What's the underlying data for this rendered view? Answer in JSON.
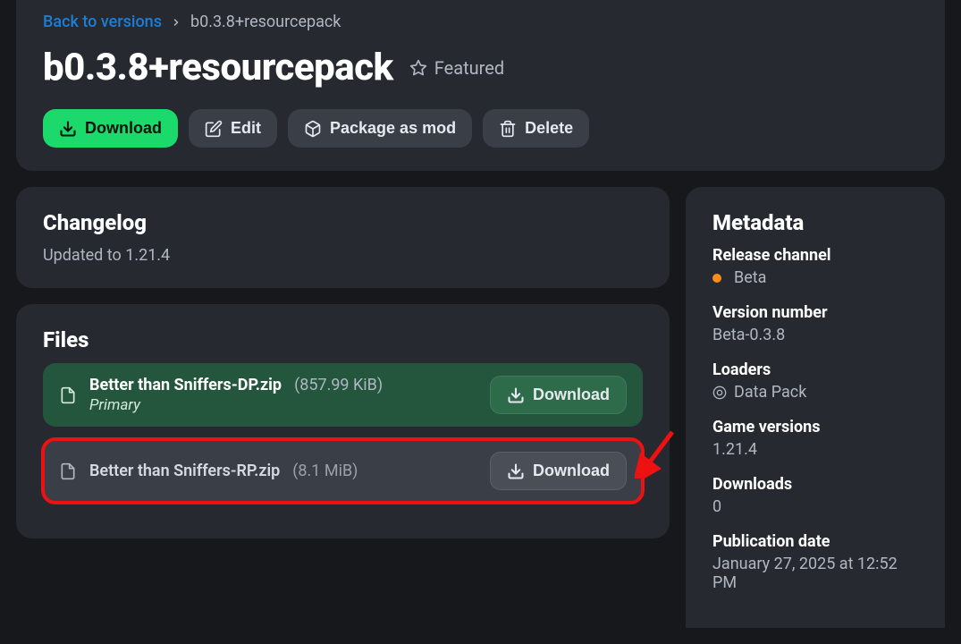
{
  "breadcrumb": {
    "back": "Back to versions",
    "current": "b0.3.8+resourcepack"
  },
  "title": "b0.3.8+resourcepack",
  "featured_label": "Featured",
  "actions": {
    "download": "Download",
    "edit": "Edit",
    "package": "Package as mod",
    "delete": "Delete"
  },
  "changelog": {
    "heading": "Changelog",
    "text": "Updated to 1.21.4"
  },
  "files": {
    "heading": "Files",
    "download_label": "Download",
    "items": [
      {
        "name": "Better than Sniffers-DP.zip",
        "size": "(857.99 KiB)",
        "tag": "Primary"
      },
      {
        "name": "Better than Sniffers-RP.zip",
        "size": "(8.1 MiB)"
      }
    ]
  },
  "metadata": {
    "heading": "Metadata",
    "release_channel_label": "Release channel",
    "release_channel": "Beta",
    "version_number_label": "Version number",
    "version_number": "Beta-0.3.8",
    "loaders_label": "Loaders",
    "loaders": "Data Pack",
    "game_versions_label": "Game versions",
    "game_versions": "1.21.4",
    "downloads_label": "Downloads",
    "downloads": "0",
    "publication_date_label": "Publication date",
    "publication_date": "January 27, 2025 at 12:52 PM"
  }
}
